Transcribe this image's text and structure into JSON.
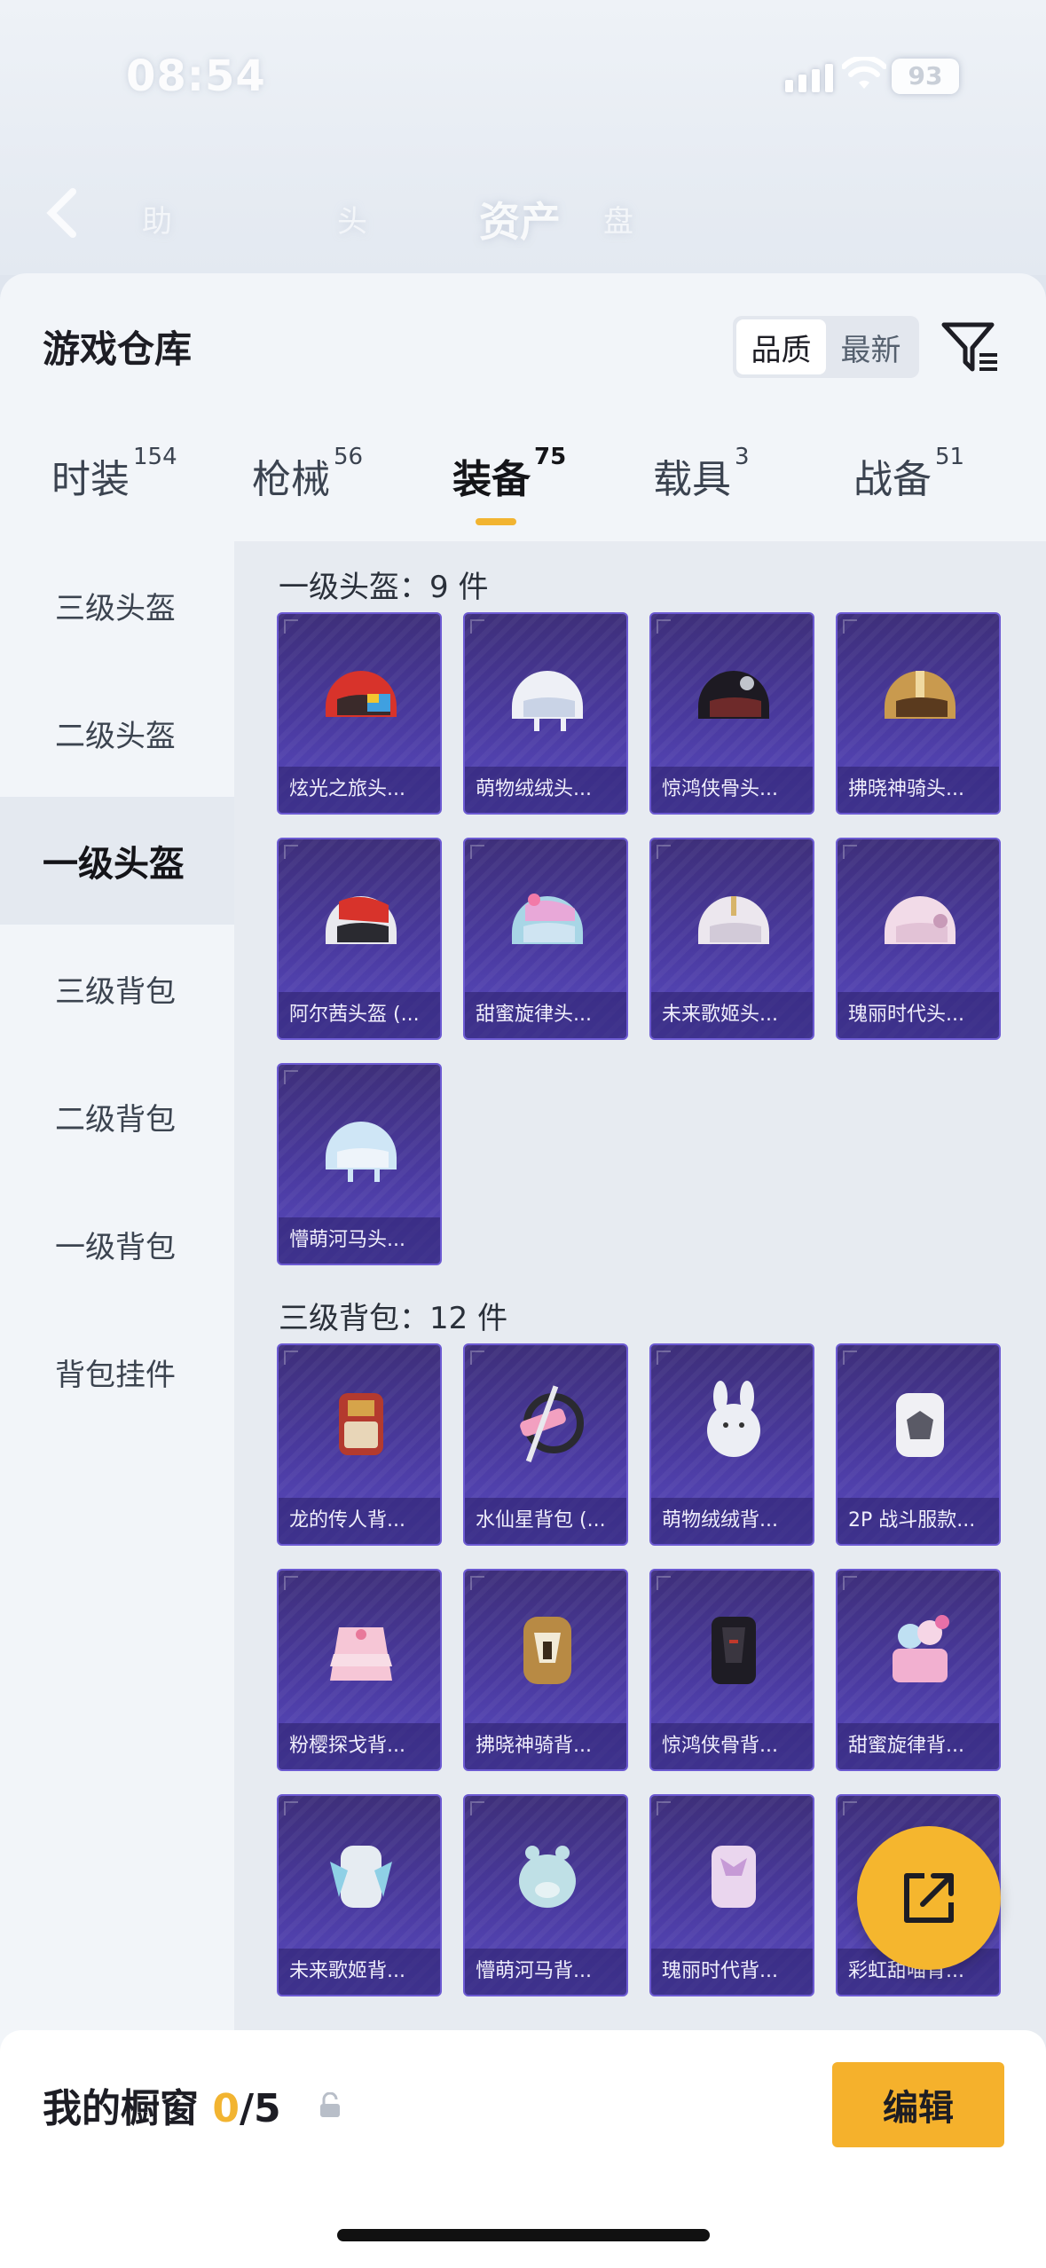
{
  "status": {
    "time": "08:54",
    "battery": "93"
  },
  "header_ghost": {
    "title": "资产"
  },
  "sheet": {
    "title": "游戏仓库",
    "sort_options": [
      "品质",
      "最新"
    ],
    "active_sort": "品质"
  },
  "tabs": [
    {
      "label": "时装",
      "count": "154"
    },
    {
      "label": "枪械",
      "count": "56"
    },
    {
      "label": "装备",
      "count": "75"
    },
    {
      "label": "载具",
      "count": "3"
    },
    {
      "label": "战备",
      "count": "51"
    }
  ],
  "sidebar": {
    "items": [
      "三级头盔",
      "二级头盔",
      "一级头盔",
      "三级背包",
      "二级背包",
      "一级背包",
      "背包挂件"
    ],
    "active": "一级头盔"
  },
  "sections": [
    {
      "title": "一级头盔：9 件",
      "items": [
        "炫光之旅头...",
        "萌物绒绒头...",
        "惊鸿侠骨头...",
        "拂晓神骑头...",
        "阿尔茜头盔 (...",
        "甜蜜旋律头...",
        "未来歌姬头...",
        "瑰丽时代头...",
        "懵萌河马头..."
      ]
    },
    {
      "title": "三级背包：12 件",
      "items": [
        "龙的传人背...",
        "水仙星背包 (...",
        "萌物绒绒背...",
        "2P 战斗服款...",
        "粉樱探戈背...",
        "拂晓神骑背...",
        "惊鸿侠骨背...",
        "甜蜜旋律背...",
        "未来歌姬背...",
        "懵萌河马背...",
        "瑰丽时代背...",
        "彩虹甜喵背..."
      ]
    }
  ],
  "bottom": {
    "showcase_label": "我的橱窗",
    "showcase_used": "0",
    "showcase_total": "/5",
    "edit_label": "编辑"
  },
  "colors": {
    "accent": "#f2b431",
    "card_bg": "#4a3aa0"
  }
}
